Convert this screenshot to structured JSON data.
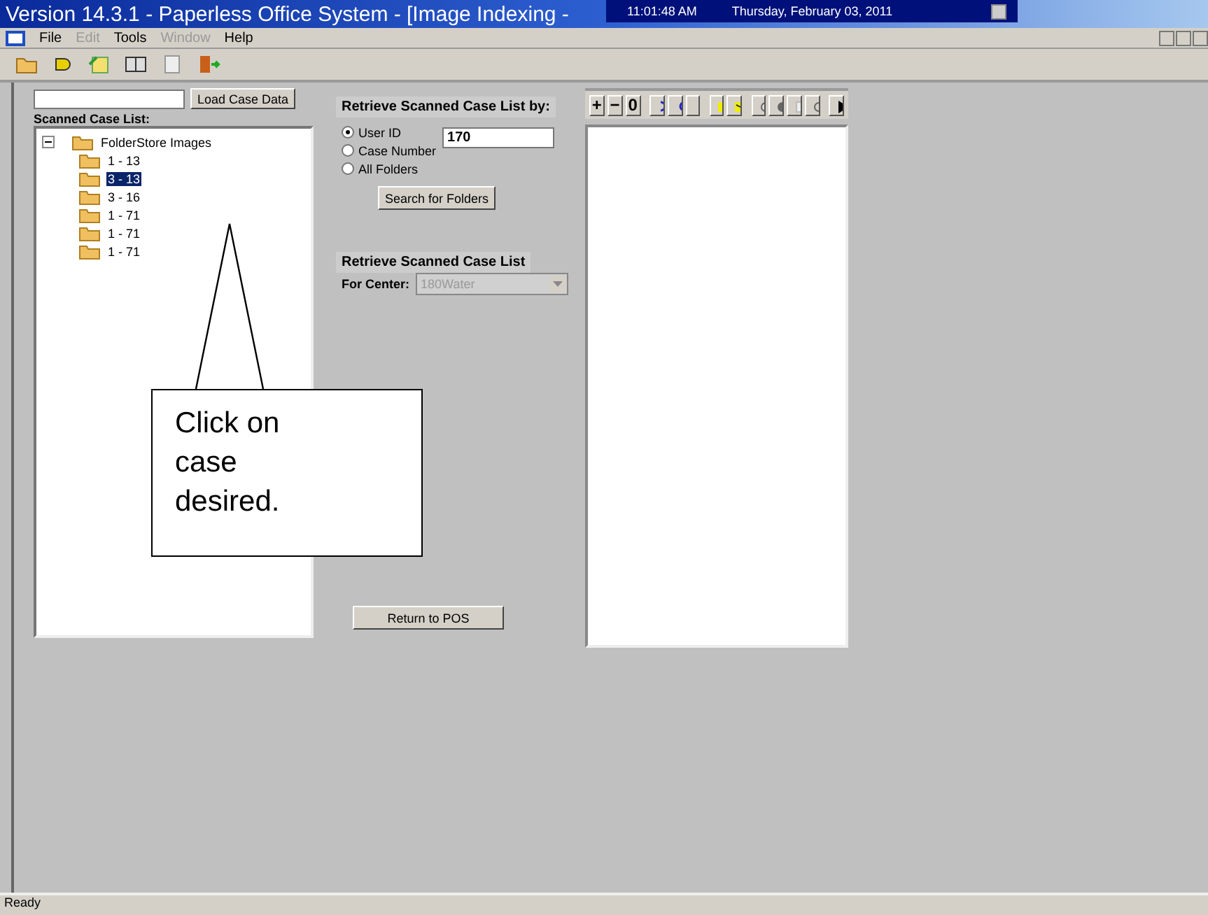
{
  "window": {
    "title": "Version 14.3.1 - Paperless Office System - [Image Indexing -"
  },
  "clock": {
    "time": "11:01:48 AM",
    "date": "Thursday, February 03, 2011"
  },
  "menu": [
    {
      "label": "File",
      "disabled": false
    },
    {
      "label": "Edit",
      "disabled": true
    },
    {
      "label": "Tools",
      "disabled": false
    },
    {
      "label": "Window",
      "disabled": true
    },
    {
      "label": "Help",
      "disabled": false
    }
  ],
  "load_button": "Load Case Data",
  "tree": {
    "label": "Scanned Case List:",
    "root": "FolderStore Images",
    "expanded": true,
    "children": [
      {
        "label": "1 - 13",
        "selected": false
      },
      {
        "label": "3 - 13",
        "selected": true
      },
      {
        "label": "3 - 16",
        "selected": false
      },
      {
        "label": "1 - 71",
        "selected": false
      },
      {
        "label": "1 - 71",
        "selected": false
      },
      {
        "label": "1 - 71",
        "selected": false
      }
    ]
  },
  "retrieve": {
    "heading": "Retrieve Scanned Case List by:",
    "options": [
      {
        "label": "User ID",
        "selected": true
      },
      {
        "label": "Case Number",
        "selected": false
      },
      {
        "label": "All Folders",
        "selected": false
      }
    ],
    "value": "170",
    "search_button": "Search for Folders"
  },
  "center": {
    "heading": "Retrieve Scanned Case List",
    "label": "For Center:",
    "value": "180Water",
    "disabled": true
  },
  "image_tools": [
    "+",
    "−",
    "0"
  ],
  "return_button": "Return to POS",
  "callout": "Click on case desired.",
  "status_bar": "Ready"
}
